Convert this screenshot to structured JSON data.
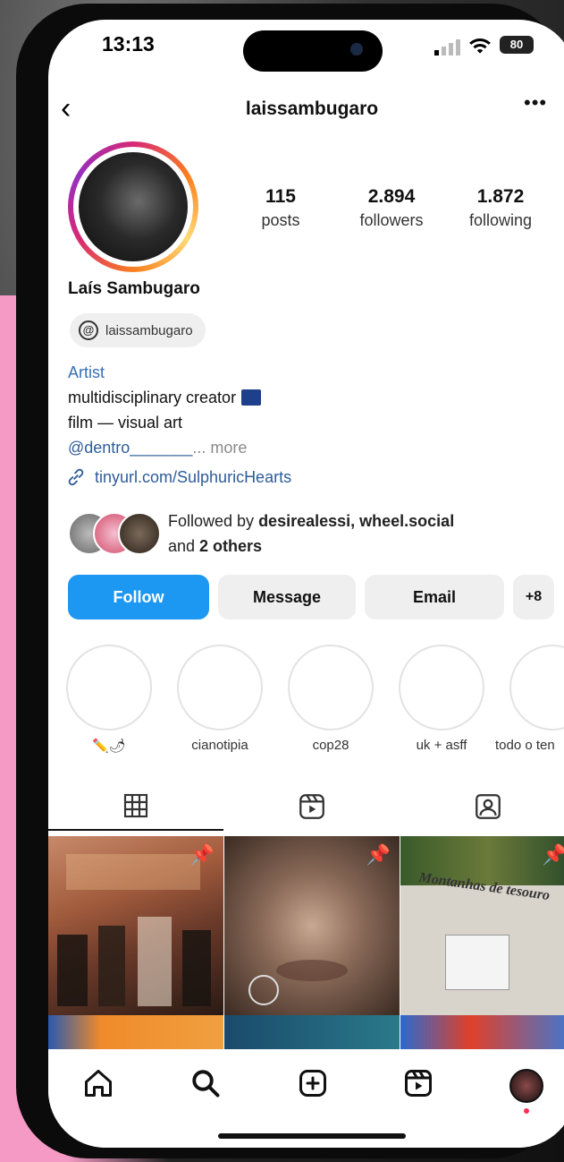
{
  "status_bar": {
    "time": "13:13",
    "battery": "80"
  },
  "header": {
    "username": "laissambugaro"
  },
  "profile": {
    "stats": [
      {
        "value": "115",
        "label": "posts"
      },
      {
        "value": "2.894",
        "label": "followers"
      },
      {
        "value": "1.872",
        "label": "following"
      }
    ],
    "full_name": "Laís Sambugaro",
    "threads_handle": "laissambugaro",
    "category": "Artist",
    "bio_line1": "multidisciplinary creator",
    "bio_line2": "film — visual art",
    "bio_mention": "@dentro_______",
    "bio_more": "... more",
    "link": "tinyurl.com/SulphuricHearts",
    "followed_by_prefix": "Followed by ",
    "followed_by_names": "desirealessi, wheel.social",
    "followed_by_and": "and ",
    "followed_by_others": "2 others"
  },
  "actions": {
    "follow": "Follow",
    "message": "Message",
    "email": "Email",
    "add": "+8"
  },
  "highlights": [
    {
      "label": "✏️🌶"
    },
    {
      "label": "cianotipia"
    },
    {
      "label": "cop28"
    },
    {
      "label": "uk + asff"
    },
    {
      "label": "todo o ten"
    }
  ],
  "tabs": [
    "grid-icon",
    "reels-icon",
    "tagged-icon"
  ],
  "posts": [
    {
      "title": "",
      "pinned": true
    },
    {
      "title": "",
      "pinned": true
    },
    {
      "title": "Montanhas de tesouro",
      "pinned": true
    }
  ],
  "bottom_nav": [
    "home-icon",
    "search-icon",
    "create-icon",
    "reels-icon",
    "profile-avatar"
  ],
  "colors": {
    "follow_button": "#1c97f2",
    "link": "#2e5c99",
    "category": "#376fb4"
  }
}
